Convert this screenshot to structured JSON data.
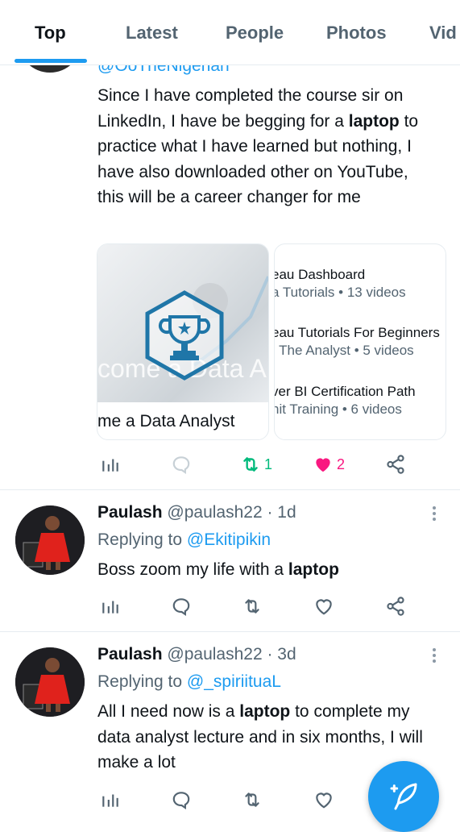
{
  "tabs": [
    {
      "label": "Top",
      "active": true
    },
    {
      "label": "Latest",
      "active": false
    },
    {
      "label": "People",
      "active": false
    },
    {
      "label": "Photos",
      "active": false
    },
    {
      "label": "Vid",
      "active": false
    }
  ],
  "tweet1": {
    "handle": "@OoTheNigerian",
    "text_parts": [
      "Since I have completed the course sir on LinkedIn, I have be begging for a ",
      "laptop",
      " to practice what I have learned but nothing, I have also downloaded other on YouTube, this will be a career changer for me"
    ],
    "card": {
      "media_text": "come a Data A",
      "caption": "me a Data Analyst",
      "playlists": [
        {
          "title": "eau Dashboard",
          "sub": "a Tutorials • 13 videos"
        },
        {
          "title": "eau Tutorials For Beginners",
          "sub": ": The Analyst • 5 videos"
        },
        {
          "title": "ver BI Certification Path",
          "sub": "nit Training • 6 videos"
        }
      ]
    },
    "retweets": "1",
    "likes": "2"
  },
  "tweet2": {
    "name": "Paulash",
    "handle_time": "@paulash22 · 1d",
    "replying_prefix": "Replying to ",
    "replying_to": "@Ekitipikin",
    "text_parts": [
      "Boss zoom my life with a ",
      "laptop",
      ""
    ]
  },
  "tweet3": {
    "name": "Paulash",
    "handle_time": "@paulash22 · 3d",
    "replying_prefix": "Replying to ",
    "replying_to": "@_spiriituaL",
    "text_parts": [
      "All I need now is a ",
      "laptop",
      " to complete my data analyst lecture and in six months, I will make a lot"
    ]
  },
  "icons": {
    "views": "bar-chart-icon",
    "reply": "speech-bubble-icon",
    "retweet": "retweet-icon",
    "like": "heart-icon",
    "share": "share-icon",
    "compose": "compose-feather-icon"
  },
  "colors": {
    "accent": "#1d9bf0",
    "retweet_active": "#00ba7c",
    "like_active": "#f91880",
    "text_secondary": "#536471"
  }
}
